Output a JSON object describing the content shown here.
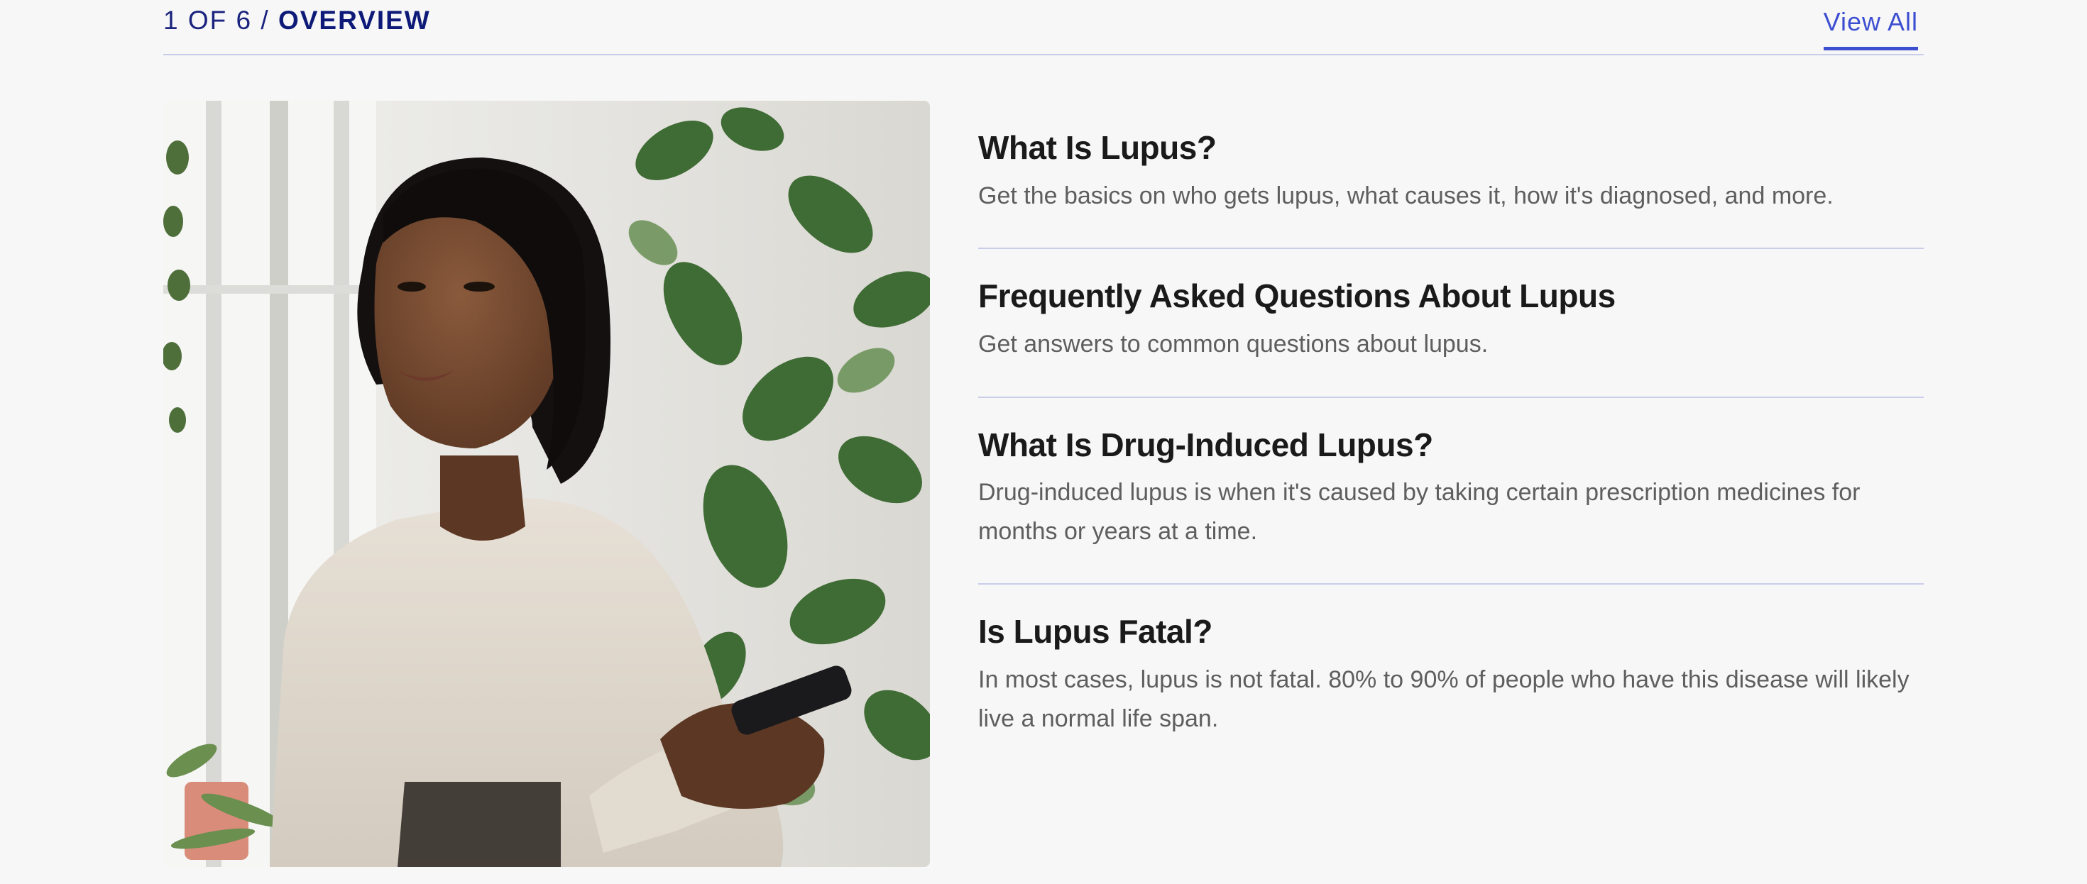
{
  "header": {
    "counter_current": "1",
    "counter_of": "OF",
    "counter_total": "6",
    "counter_separator": "/",
    "section": "OVERVIEW",
    "view_all": "View All"
  },
  "colors": {
    "background": "#f7f7f7",
    "accent": "#3d4fd1",
    "heading_navy": "#0d1a78",
    "divider": "#c9cdea"
  },
  "hero_image": {
    "description": "woman-with-phone-photo"
  },
  "articles": [
    {
      "title": "What Is Lupus?",
      "description": "Get the basics on who gets lupus, what causes it, how it's diagnosed, and more."
    },
    {
      "title": "Frequently Asked Questions About Lupus",
      "description": "Get answers to common questions about lupus."
    },
    {
      "title": "What Is Drug-Induced Lupus?",
      "description": " Drug-induced lupus is when it's caused by taking certain prescription medicines for months or years at a time."
    },
    {
      "title": "Is Lupus Fatal?",
      "description": "In most cases, lupus is not fatal. 80% to 90% of people who have this disease will likely live a normal life span."
    }
  ]
}
